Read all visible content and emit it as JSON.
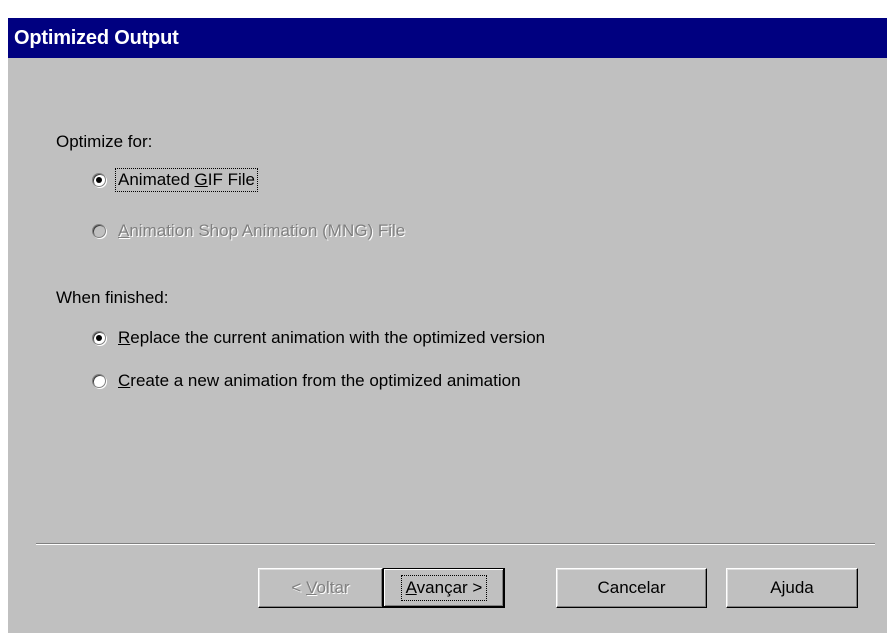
{
  "dialog": {
    "title": "Optimized Output"
  },
  "optimize_for": {
    "label": "Optimize for:",
    "options": [
      {
        "label": "Animated GIF File",
        "mnemonic": "G",
        "selected": true,
        "enabled": true
      },
      {
        "label": "Animation Shop Animation (MNG) File",
        "mnemonic": "A",
        "selected": false,
        "enabled": false
      }
    ]
  },
  "when_finished": {
    "label": "When finished:",
    "options": [
      {
        "label": "Replace the current animation with the optimized version",
        "mnemonic": "R",
        "selected": true,
        "enabled": true
      },
      {
        "label": "Create a new animation from the optimized animation",
        "mnemonic": "C",
        "selected": false,
        "enabled": true
      }
    ]
  },
  "buttons": {
    "back": "< Voltar",
    "next": "Avançar >",
    "cancel": "Cancelar",
    "help": "Ajuda"
  },
  "colors": {
    "title_bar": "#000080",
    "face": "#c0c0c0",
    "disabled_text": "#808080"
  }
}
